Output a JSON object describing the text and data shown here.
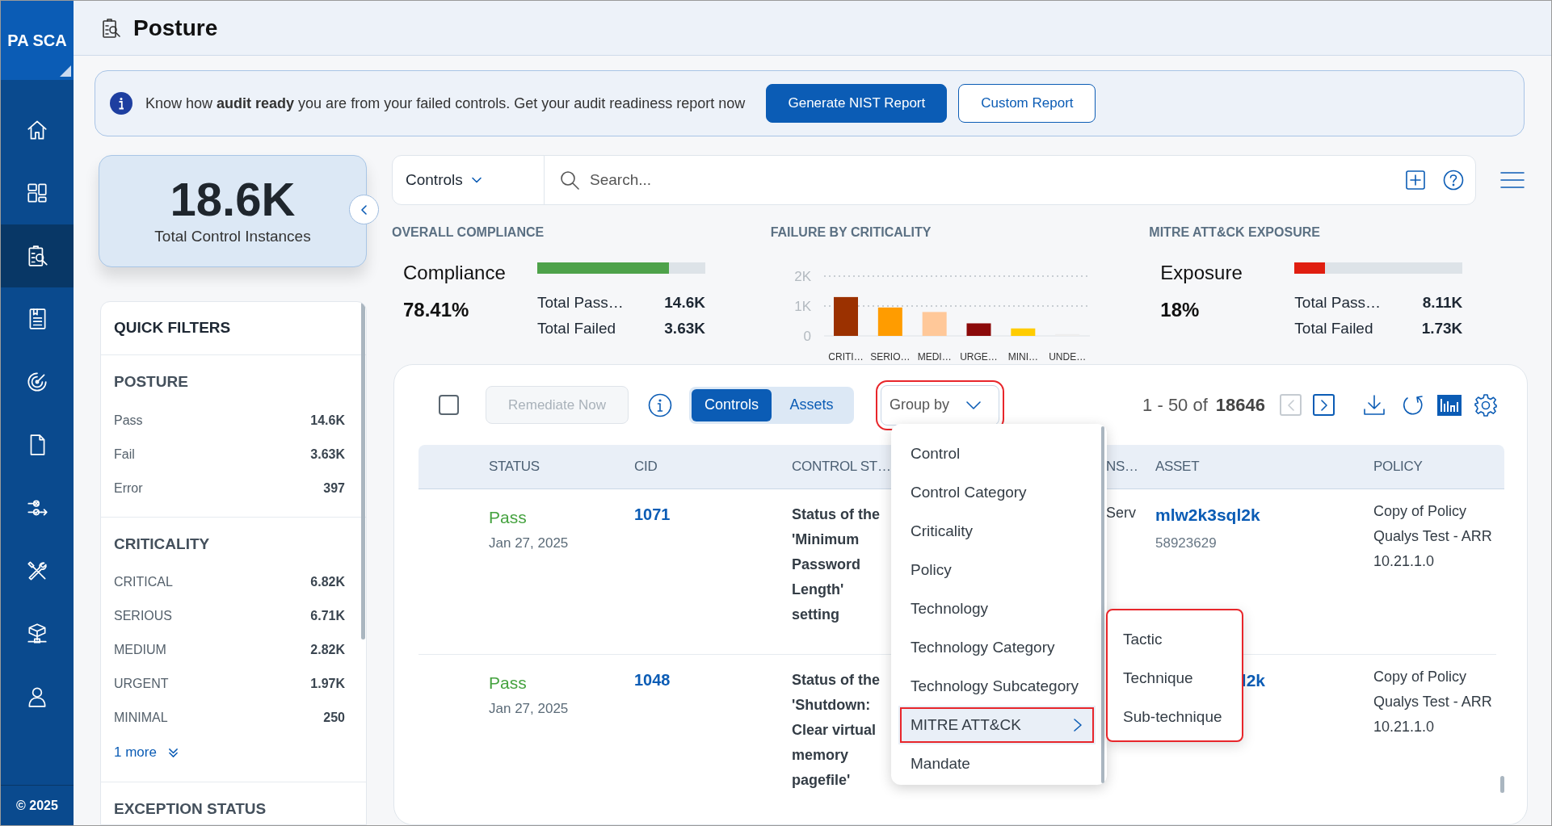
{
  "sidebar": {
    "logo": "PA SCA",
    "items": [
      {
        "kind": "home",
        "selected": false
      },
      {
        "kind": "dashboard",
        "selected": false
      },
      {
        "kind": "posture",
        "selected": true
      },
      {
        "kind": "report",
        "selected": false
      },
      {
        "kind": "gauge",
        "selected": false
      },
      {
        "kind": "document",
        "selected": false
      },
      {
        "kind": "flows",
        "selected": false
      },
      {
        "kind": "tools",
        "selected": false
      },
      {
        "kind": "network",
        "selected": false
      },
      {
        "kind": "user",
        "selected": false
      }
    ],
    "footer": "© 2025"
  },
  "header": {
    "title": "Posture"
  },
  "banner": {
    "message": "Know how **audit ready** you are from your failed controls. Get your audit readiness report now",
    "buttons": [
      {
        "label": "Generate NIST Report",
        "kind": "primary"
      },
      {
        "label": "Custom Report",
        "kind": "secondary"
      }
    ]
  },
  "total_card": {
    "value": "18.6K",
    "label": "Total Control Instances"
  },
  "quick_filters": {
    "title": "QUICK FILTERS",
    "sections": [
      {
        "title": "POSTURE",
        "items": [
          {
            "label": "Pass",
            "count": "14.6K"
          },
          {
            "label": "Fail",
            "count": "3.63K"
          },
          {
            "label": "Error",
            "count": "397"
          }
        ]
      },
      {
        "title": "CRITICALITY",
        "items": [
          {
            "label": "CRITICAL",
            "count": "6.82K"
          },
          {
            "label": "SERIOUS",
            "count": "6.71K"
          },
          {
            "label": "MEDIUM",
            "count": "2.82K"
          },
          {
            "label": "URGENT",
            "count": "1.97K"
          },
          {
            "label": "MINIMAL",
            "count": "250"
          }
        ],
        "more": "1 more"
      },
      {
        "title": "EXCEPTION STATUS"
      }
    ]
  },
  "search": {
    "scope": "Controls",
    "placeholder": "Search..."
  },
  "overall_compliance": {
    "heading": "OVERALL COMPLIANCE",
    "label": "Compliance",
    "value": "78.41%",
    "level": 0.7841,
    "color": "#4ea24a",
    "rows": [
      {
        "label": "Total Pass…",
        "value": "14.6K"
      },
      {
        "label": "Total Failed",
        "value": "3.63K"
      }
    ]
  },
  "failure_by_criticality": {
    "heading": "FAILURE BY CRITICALITY",
    "chart_data": {
      "type": "bar",
      "categories": [
        "CRITI…",
        "SERIO…",
        "MEDI…",
        "URGE…",
        "MINI…",
        "UNDE…"
      ],
      "values": [
        1300,
        950,
        800,
        420,
        250,
        60
      ],
      "colors": [
        "#9b3100",
        "#ff9c00",
        "#ffc899",
        "#8b0a0a",
        "#ffcc00",
        "#eeeeee"
      ],
      "ylim": [
        0,
        2000
      ],
      "yticks": [
        {
          "value": 0,
          "label": "0"
        },
        {
          "value": 1000,
          "label": "1K"
        },
        {
          "value": 2000,
          "label": "2K"
        }
      ]
    }
  },
  "mitre_exposure": {
    "heading": "MITRE ATT&CK EXPOSURE",
    "label": "Exposure",
    "value": "18%",
    "level": 0.18,
    "color": "#e01e10",
    "rows": [
      {
        "label": "Total Pass…",
        "value": "8.11K"
      },
      {
        "label": "Total Failed",
        "value": "1.73K"
      }
    ]
  },
  "table": {
    "toolbar": {
      "select_all_checked": false,
      "remediate": {
        "label": "Remediate Now",
        "disabled": true
      },
      "view_tabs": [
        {
          "label": "Controls",
          "selected": true
        },
        {
          "label": "Assets",
          "selected": false
        }
      ],
      "group_by": {
        "label": "Group by",
        "expanded": true,
        "highlighted": true
      },
      "range": "1 - 50 of",
      "total": "18646",
      "prev_disabled": true,
      "next_disabled": false
    },
    "columns": [
      "STATUS",
      "CID",
      "CONTROL ST…",
      "NS…",
      "ASSET",
      "POLICY"
    ],
    "rows": [
      {
        "status": "Pass",
        "date": "Jan 27, 2025",
        "cid": "1071",
        "statement": "Status of the 'Minimum Password Length' setting",
        "column_4": "Serv",
        "asset": "mlw2k3sql2k",
        "asset_id": "58923629",
        "policy": "Copy of Policy Qualys Test - ARR 10.21.1.0"
      },
      {
        "status": "Pass",
        "date": "Jan 27, 2025",
        "cid": "1048",
        "statement": "Status of the 'Shutdown: Clear virtual memory pagefile'",
        "asset": "l2k",
        "policy": "Copy of Policy Qualys Test - ARR 10.21.1.0"
      }
    ]
  },
  "group_by_menu": {
    "items": [
      {
        "label": "Control",
        "selected": false
      },
      {
        "label": "Control Category",
        "selected": false
      },
      {
        "label": "Criticality",
        "selected": false
      },
      {
        "label": "Policy",
        "selected": false
      },
      {
        "label": "Technology",
        "selected": false
      },
      {
        "label": "Technology Category",
        "selected": false
      },
      {
        "label": "Technology Subcategory",
        "selected": false
      },
      {
        "label": "MITRE ATT&CK",
        "selected": true,
        "highlighted": true,
        "expanded": true,
        "children_highlighted": true,
        "children": [
          {
            "label": "Tactic"
          },
          {
            "label": "Technique"
          },
          {
            "label": "Sub-technique"
          }
        ]
      },
      {
        "label": "Mandate",
        "selected": false
      }
    ]
  }
}
